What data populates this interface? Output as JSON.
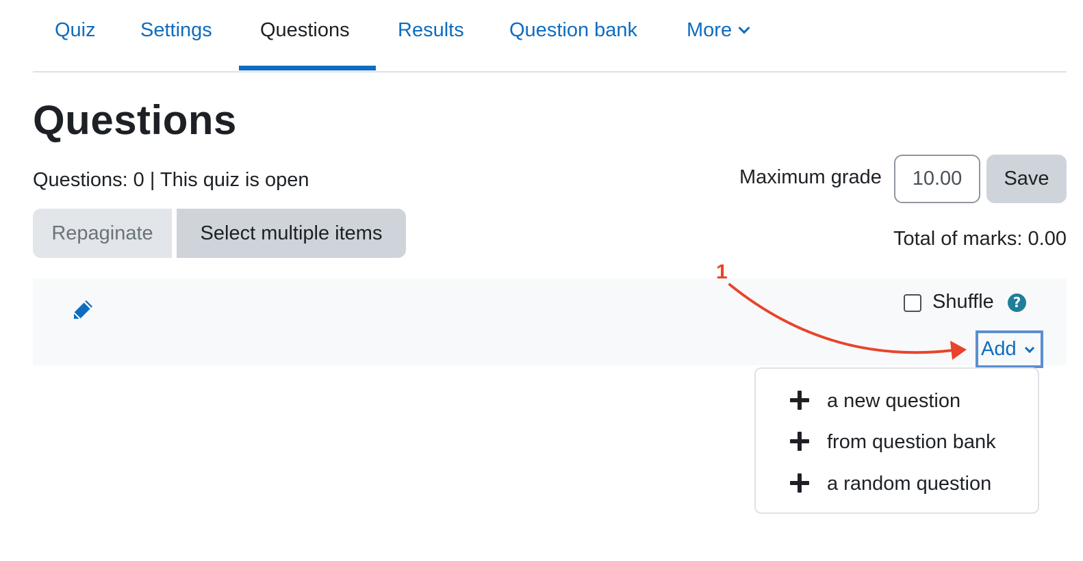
{
  "tabs": {
    "items": [
      {
        "label": "Quiz"
      },
      {
        "label": "Settings"
      },
      {
        "label": "Questions"
      },
      {
        "label": "Results"
      },
      {
        "label": "Question bank"
      },
      {
        "label": "More"
      }
    ],
    "active": "Questions"
  },
  "page": {
    "title": "Questions",
    "status": "Questions: 0 | This quiz is open"
  },
  "toolbar": {
    "repaginate_label": "Repaginate",
    "select_multiple_label": "Select multiple items"
  },
  "grade": {
    "max_grade_label": "Maximum grade",
    "max_grade_value": "10.00",
    "save_label": "Save",
    "total_marks": "Total of marks: 0.00"
  },
  "section": {
    "shuffle_label": "Shuffle",
    "shuffle_checked": false,
    "help_glyph": "?",
    "add_label": "Add"
  },
  "add_menu": {
    "items": [
      {
        "label": "a new question",
        "icon": "plus-icon"
      },
      {
        "label": "from question bank",
        "icon": "plus-icon"
      },
      {
        "label": "a random question",
        "icon": "plus-icon"
      }
    ]
  },
  "annotation": {
    "number": "1",
    "color": "#e8442b"
  },
  "colors": {
    "link": "#0f6cbf",
    "text": "#1d2125",
    "button_bg": "#ced4da",
    "panel_bg": "#f8f9fa",
    "help_icon": "#1f7e9a"
  }
}
